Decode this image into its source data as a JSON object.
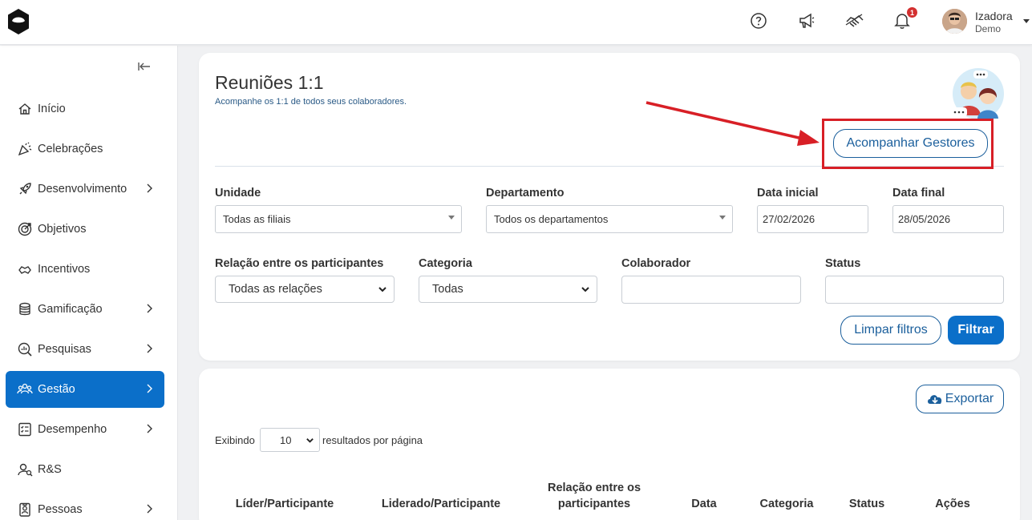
{
  "header": {
    "notifications_count": "1",
    "user": {
      "name": "Izadora",
      "role": "Demo"
    },
    "icons": [
      "help-icon",
      "megaphone-icon",
      "handshake-icon",
      "bell-icon"
    ]
  },
  "sidebar": {
    "items": [
      {
        "label": "Início",
        "icon": "home-icon",
        "chevron": false,
        "active": false
      },
      {
        "label": "Celebrações",
        "icon": "party-icon",
        "chevron": false,
        "active": false
      },
      {
        "label": "Desenvolvimento",
        "icon": "rocket-icon",
        "chevron": true,
        "active": false
      },
      {
        "label": "Objetivos",
        "icon": "target-icon",
        "chevron": false,
        "active": false
      },
      {
        "label": "Incentivos",
        "icon": "incentive-icon",
        "chevron": false,
        "active": false
      },
      {
        "label": "Gamificação",
        "icon": "coins-icon",
        "chevron": true,
        "active": false
      },
      {
        "label": "Pesquisas",
        "icon": "survey-icon",
        "chevron": true,
        "active": false
      },
      {
        "label": "Gestão",
        "icon": "team-icon",
        "chevron": true,
        "active": true
      },
      {
        "label": "Desempenho",
        "icon": "checklist-icon",
        "chevron": true,
        "active": false
      },
      {
        "label": "R&S",
        "icon": "recruit-icon",
        "chevron": false,
        "active": false
      },
      {
        "label": "Pessoas",
        "icon": "people-icon",
        "chevron": true,
        "active": false
      }
    ]
  },
  "page": {
    "title": "Reuniões 1:1",
    "subtitle": "Acompanhe os 1:1 de todos seus colaboradores.",
    "track_managers_label": "Acompanhar Gestores"
  },
  "filters": {
    "unit": {
      "label": "Unidade",
      "value": "Todas as filiais"
    },
    "department": {
      "label": "Departamento",
      "value": "Todos os departamentos"
    },
    "start_date": {
      "label": "Data inicial",
      "value": "27/02/2026"
    },
    "end_date": {
      "label": "Data final",
      "value": "28/05/2026"
    },
    "relation": {
      "label": "Relação entre os participantes",
      "value": "Todas as relações"
    },
    "category": {
      "label": "Categoria",
      "value": "Todas"
    },
    "employee": {
      "label": "Colaborador",
      "value": ""
    },
    "status": {
      "label": "Status",
      "value": ""
    },
    "clear_label": "Limpar filtros",
    "filter_label": "Filtrar"
  },
  "table": {
    "export_label": "Exportar",
    "showing_label": "Exibindo",
    "per_page_value": "10",
    "per_page_suffix": "resultados por página",
    "columns": [
      "Líder/Participante",
      "Liderado/Participante",
      "Relação entre os participantes",
      "Data",
      "Categoria",
      "Status",
      "Ações"
    ]
  },
  "colors": {
    "accent": "#0b6fc9",
    "outline": "#1b5f9c",
    "highlight": "#d81f26"
  }
}
